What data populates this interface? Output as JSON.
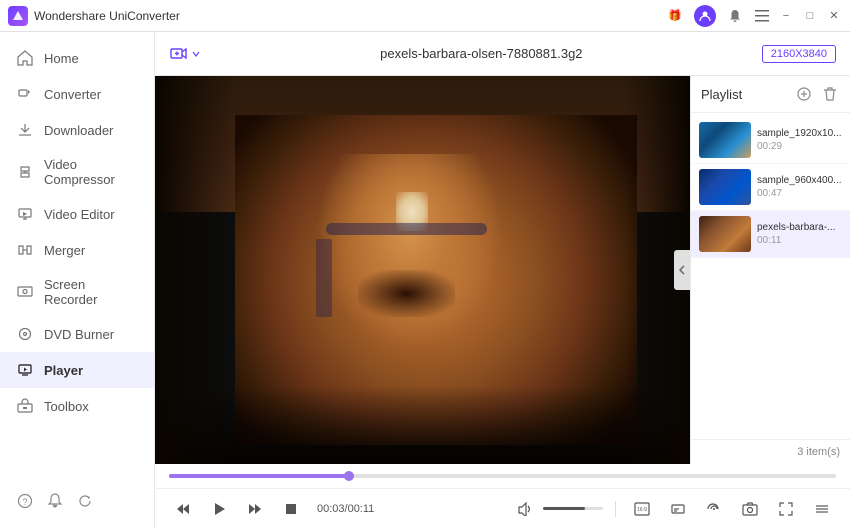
{
  "app": {
    "title": "Wondershare UniConverter"
  },
  "titlebar": {
    "gift_icon": "🎁",
    "minimize_label": "−",
    "maximize_label": "□",
    "close_label": "✕"
  },
  "sidebar": {
    "items": [
      {
        "id": "home",
        "label": "Home"
      },
      {
        "id": "converter",
        "label": "Converter"
      },
      {
        "id": "downloader",
        "label": "Downloader"
      },
      {
        "id": "video-compressor",
        "label": "Video Compressor"
      },
      {
        "id": "video-editor",
        "label": "Video Editor"
      },
      {
        "id": "merger",
        "label": "Merger"
      },
      {
        "id": "screen-recorder",
        "label": "Screen Recorder"
      },
      {
        "id": "dvd-burner",
        "label": "DVD Burner"
      },
      {
        "id": "player",
        "label": "Player"
      },
      {
        "id": "toolbox",
        "label": "Toolbox"
      }
    ]
  },
  "toolbar": {
    "filename": "pexels-barbara-olsen-7880881.3g2",
    "resolution": "2160X3840",
    "add_button_label": "+"
  },
  "playlist": {
    "title": "Playlist",
    "items": [
      {
        "name": "sample_1920x10...",
        "duration": "00:29",
        "thumb": "1"
      },
      {
        "name": "sample_960x400...",
        "duration": "00:47",
        "thumb": "2"
      },
      {
        "name": "pexels-barbara-...",
        "duration": "00:11",
        "thumb": "3"
      }
    ],
    "count": "3 item(s)"
  },
  "player": {
    "current_time": "00:03",
    "total_time": "00:11",
    "progress_percent": 27
  },
  "controls": {
    "rewind": "⏮",
    "play": "▶",
    "step_forward": "⏭",
    "stop": "■",
    "volume_icon": "🔊"
  }
}
